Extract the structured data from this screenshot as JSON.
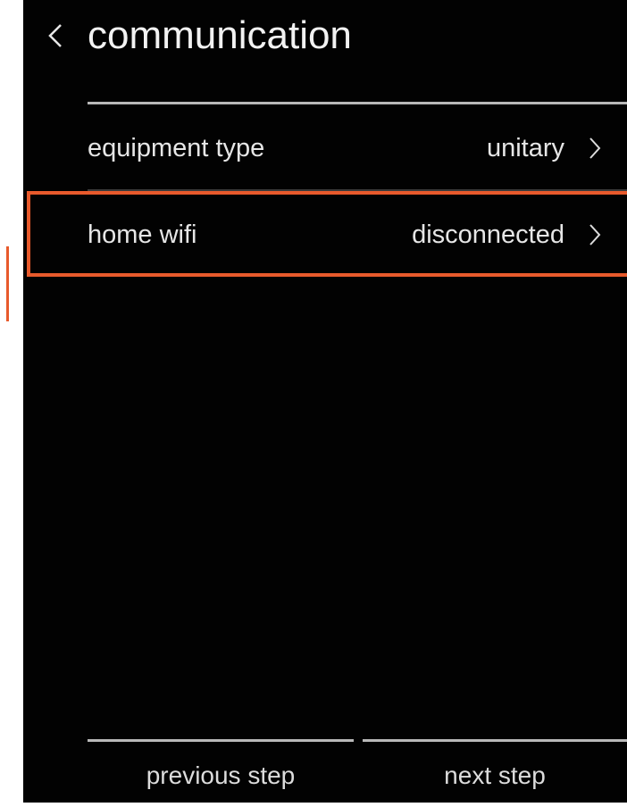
{
  "header": {
    "back_icon": "chevron-left-icon",
    "title": "communication"
  },
  "settings": {
    "items": [
      {
        "label": "equipment type",
        "value": "unitary",
        "icon": "chevron-right-icon"
      },
      {
        "label": "home wifi",
        "value": "disconnected",
        "icon": "chevron-right-icon",
        "highlighted": true
      }
    ]
  },
  "footer": {
    "previous_label": "previous step",
    "next_label": "next step"
  },
  "colors": {
    "background": "#020202",
    "text": "#e6e6e6",
    "divider": "#b8b8b8",
    "highlight": "#e85a2c"
  }
}
